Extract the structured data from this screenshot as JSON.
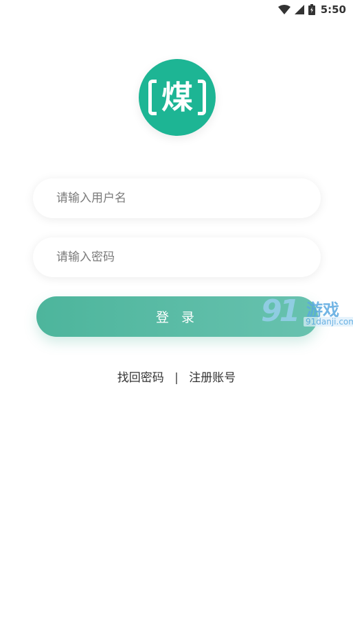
{
  "status_bar": {
    "time": "5:50",
    "icons": [
      "wifi-icon",
      "cell-signal-icon",
      "battery-icon"
    ]
  },
  "logo": {
    "char": "煤",
    "color": "#1db594"
  },
  "form": {
    "username_placeholder": "请输入用户名",
    "password_placeholder": "请输入密码",
    "login_label": "登 录"
  },
  "links": {
    "forgot_password": "找回密码",
    "separator": "|",
    "register": "注册账号"
  },
  "watermark": {
    "number": "91",
    "text": "游戏",
    "domain": "91danji.com"
  },
  "colors": {
    "accent": "#4db59c",
    "accent_light": "#68c2af",
    "text": "#333333",
    "placeholder": "#7a7a7a"
  }
}
